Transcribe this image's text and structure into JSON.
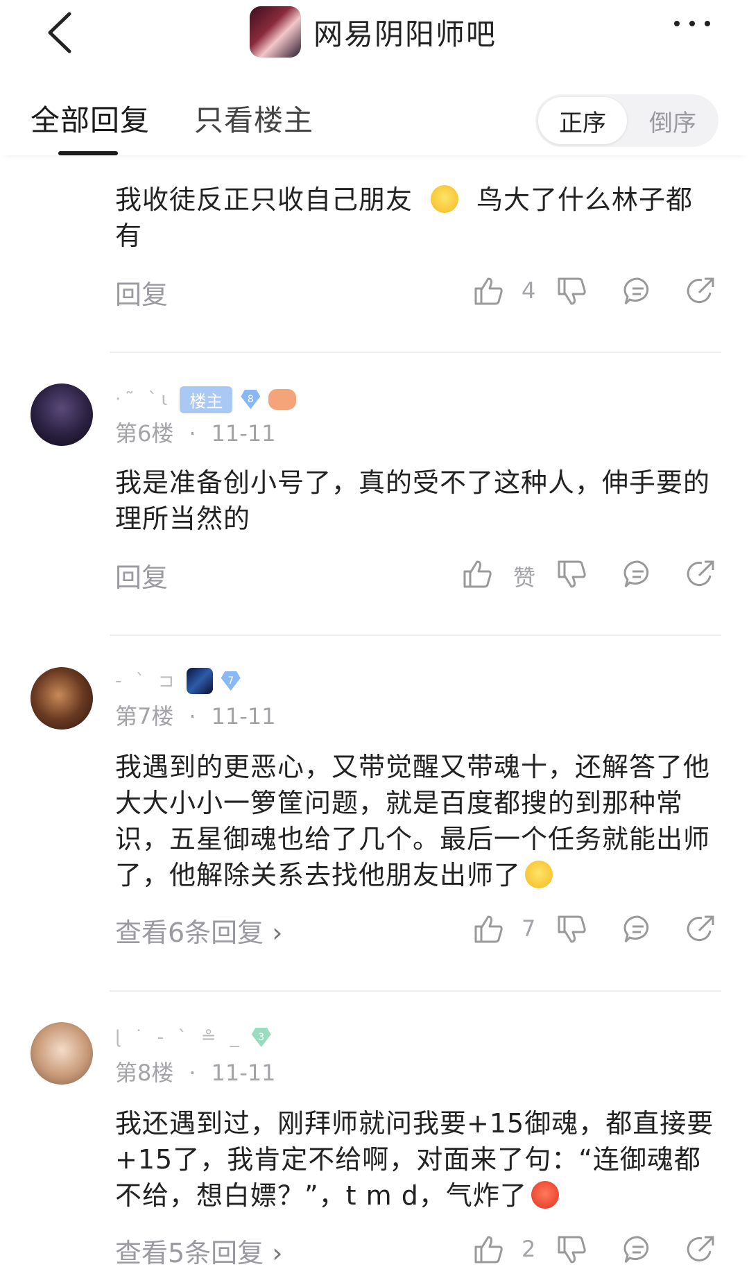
{
  "header": {
    "forum_name": "网易阴阳师吧"
  },
  "tabs": {
    "all_replies": "全部回复",
    "only_op": "只看楼主",
    "sort_asc": "正序",
    "sort_desc": "倒序"
  },
  "posts": [
    {
      "content_a": "我收徒反正只收自己朋友",
      "content_b": "鸟大了什么林子都有",
      "reply_label": "回复",
      "likes": "4"
    },
    {
      "floor": "第6楼",
      "date": "11-11",
      "owner_tag": "楼主",
      "level": "8",
      "content": "我是准备创小号了，真的受不了这种人，伸手要的理所当然的",
      "reply_label": "回复",
      "likes": "赞"
    },
    {
      "floor": "第7楼",
      "date": "11-11",
      "level": "7",
      "content": "我遇到的更恶心，又带觉醒又带魂十，还解答了他大大小小一箩筐问题，就是百度都搜的到那种常识，五星御魂也给了几个。最后一个任务就能出师了，他解除关系去找他朋友出师了",
      "view_replies": "查看6条回复",
      "likes": "7"
    },
    {
      "floor": "第8楼",
      "date": "11-11",
      "level": "3",
      "content": "我还遇到过，刚拜师就问我要+15御魂，都直接要+15了，我肯定不给啊，对面来了句：“连御魂都不给，想白嫖？”，t m d，气炸了",
      "view_replies": "查看5条回复",
      "likes": "2"
    }
  ]
}
